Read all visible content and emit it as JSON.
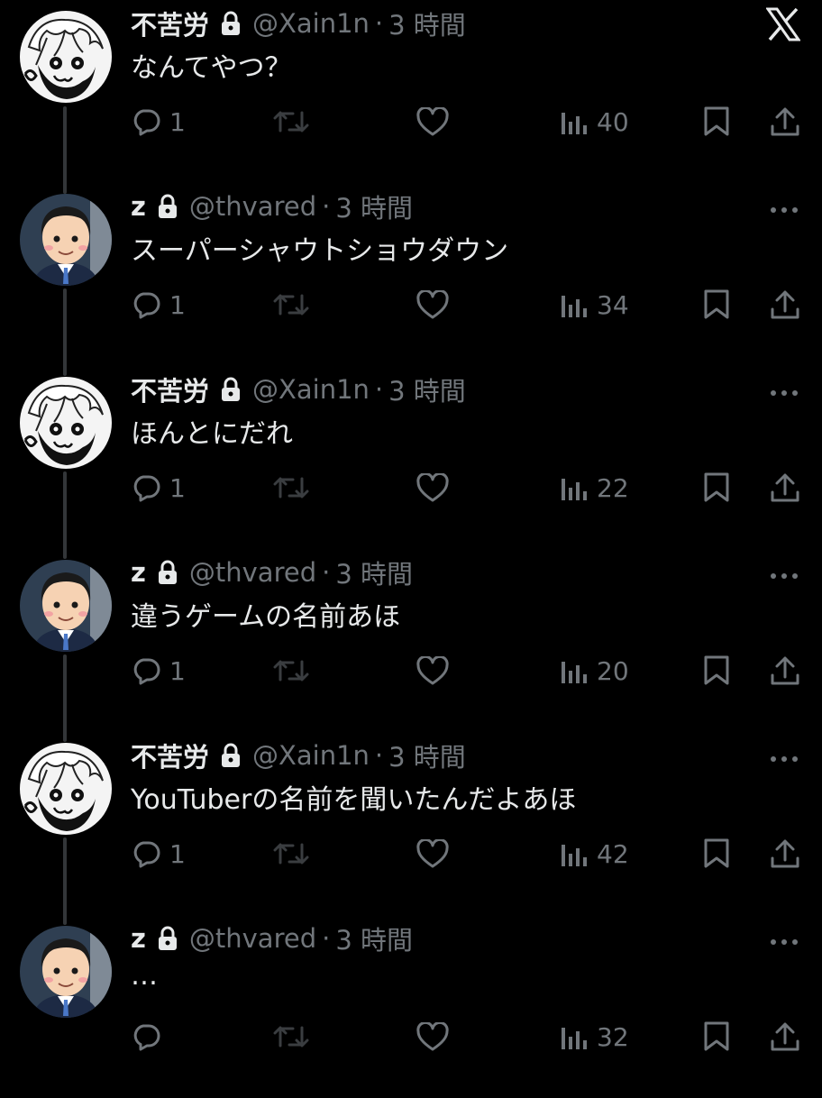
{
  "app": {
    "brand_icon": "x-logo-icon"
  },
  "users": {
    "a": {
      "name": "不苦労",
      "handle": "@Xain1n"
    },
    "b": {
      "name": "z",
      "handle": "@thvared"
    }
  },
  "separator": "·",
  "tweets": [
    {
      "author": "a",
      "time": "3 時間",
      "text": "なんてやつ？",
      "replies": "1",
      "views": "40"
    },
    {
      "author": "b",
      "time": "3 時間",
      "text": "スーパーシャウトショウダウン",
      "replies": "1",
      "views": "34"
    },
    {
      "author": "a",
      "time": "3 時間",
      "text": "ほんとにだれ",
      "replies": "1",
      "views": "22"
    },
    {
      "author": "b",
      "time": "3 時間",
      "text": "違うゲームの名前あほ",
      "replies": "1",
      "views": "20"
    },
    {
      "author": "a",
      "time": "3 時間",
      "text": "YouTuberの名前を聞いたんだよあほ",
      "replies": "1",
      "views": "42"
    },
    {
      "author": "b",
      "time": "3 時間",
      "text": "…",
      "replies": "",
      "views": "32"
    }
  ],
  "colors": {
    "background": "#000000",
    "text_primary": "#e7e9ea",
    "text_secondary": "#71767b",
    "thread_line": "#333639"
  }
}
